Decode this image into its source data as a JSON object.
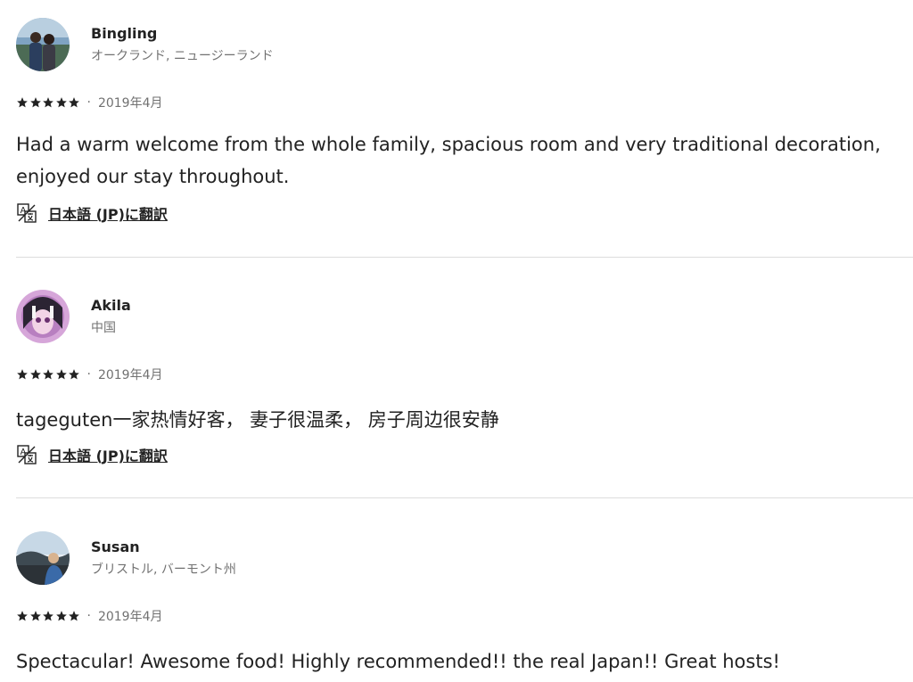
{
  "reviews": [
    {
      "name": "Bingling",
      "location": "オークランド, ニュージーランド",
      "rating": 5,
      "date": "2019年4月",
      "separator": "·",
      "comment": "Had a warm welcome from the whole family, spacious room and very traditional decoration, enjoyed our stay throughout.",
      "translate_label": "日本語 (JP)に翻訳",
      "avatar_icon": "couple-photo-avatar"
    },
    {
      "name": "Akila",
      "location": "中国",
      "rating": 5,
      "date": "2019年4月",
      "separator": "·",
      "comment": "tageguten一家热情好客， 妻子很温柔， 房子周边很安静",
      "translate_label": "日本語 (JP)に翻訳",
      "avatar_icon": "anime-girl-avatar"
    },
    {
      "name": "Susan",
      "location": "ブリストル, バーモント州",
      "rating": 5,
      "date": "2019年4月",
      "separator": "·",
      "comment": "Spectacular! Awesome food! Highly recommended!! the real Japan!! Great hosts!",
      "avatar_icon": "person-landscape-avatar"
    }
  ],
  "colors": {
    "text": "#222222",
    "secondary_text": "#717171",
    "divider": "#dddddd"
  }
}
